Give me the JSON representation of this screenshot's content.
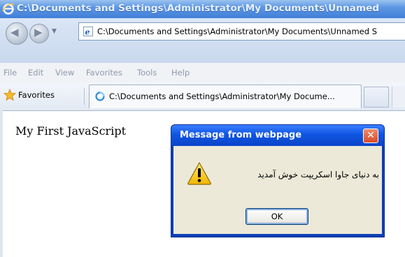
{
  "window": {
    "title": "C:\\Documents and Settings\\Administrator\\My Documents\\Unnamed"
  },
  "address_bar": {
    "url": "C:\\Documents and Settings\\Administrator\\My Documents\\Unnamed S"
  },
  "menu": {
    "items": [
      "File",
      "Edit",
      "View",
      "Favorites",
      "Tools",
      "Help"
    ]
  },
  "favorites_bar": {
    "favorites_label": "Favorites",
    "tab_label": "C:\\Documents and Settings\\Administrator\\My Docume..."
  },
  "page": {
    "heading": "My First JavaScript"
  },
  "dialog": {
    "title": "Message from webpage",
    "close_glyph": "✕",
    "message": "به دنیای جاوا اسکریپت خوش آمدید",
    "ok_label": "OK",
    "icon": "warning-icon"
  },
  "colors": {
    "titlebar": "#3f7fd8",
    "dialog_title": "#0f55e2",
    "dialog_body": "#ece9d8",
    "close_button": "#d84a25"
  }
}
